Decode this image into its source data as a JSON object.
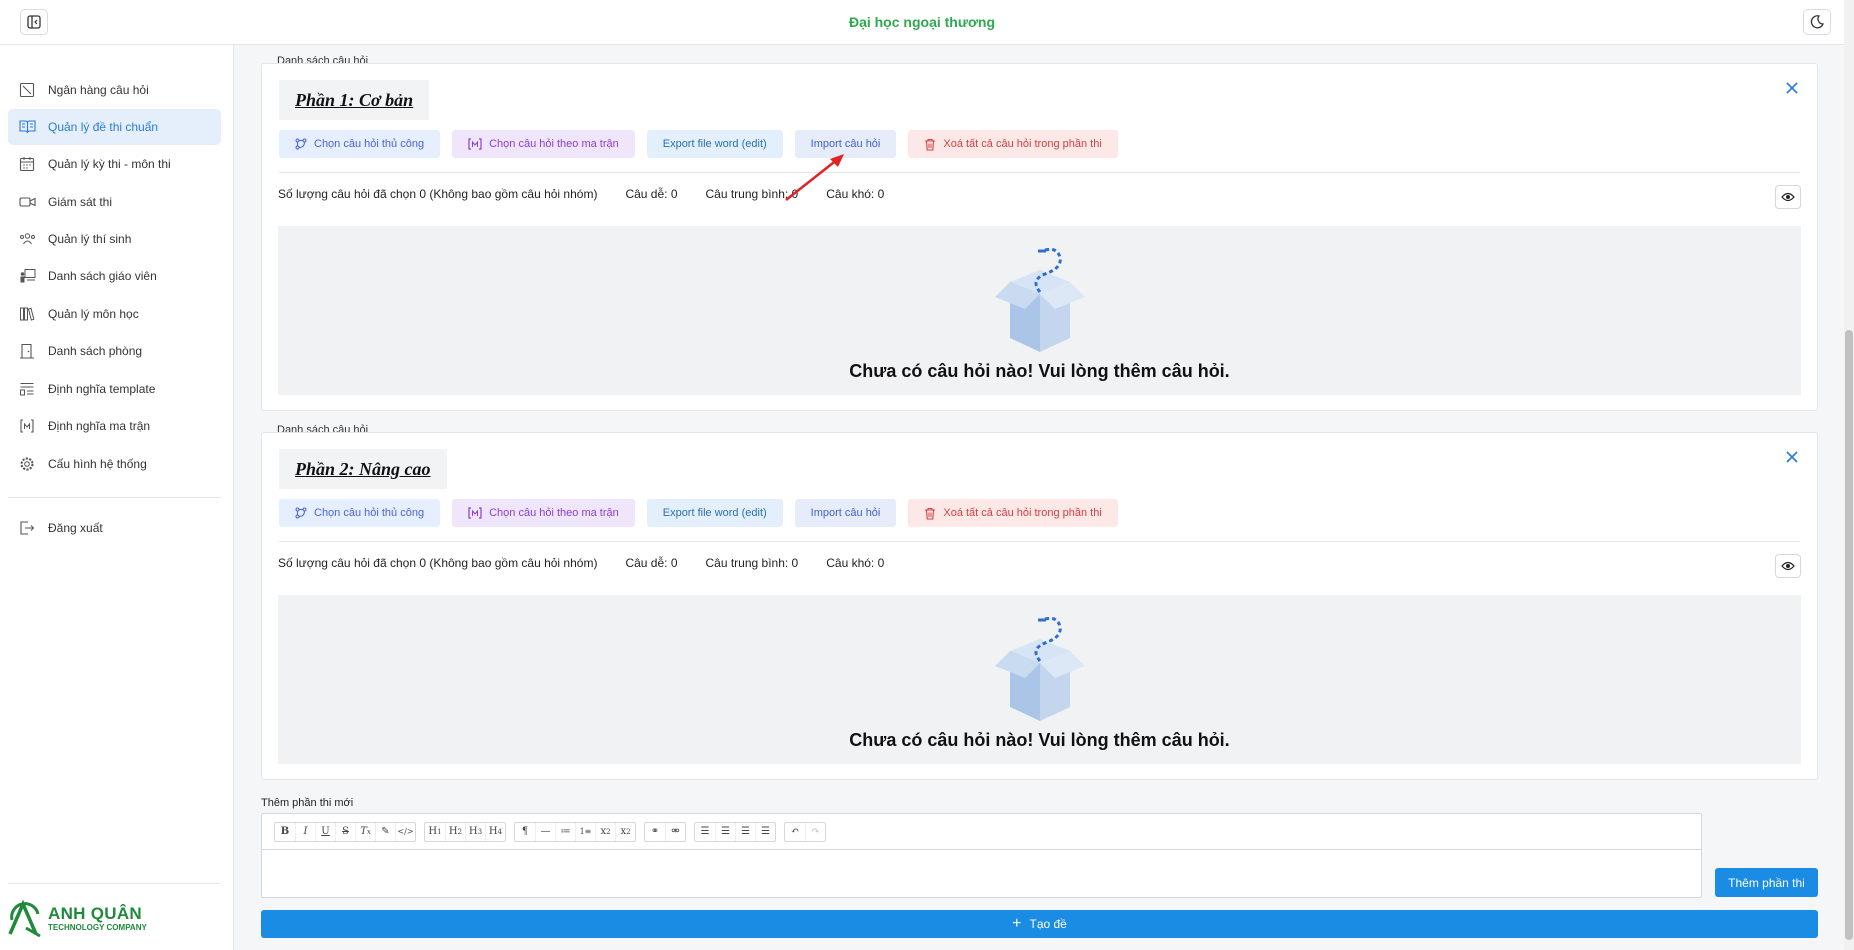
{
  "header": {
    "title": "Đại học ngoại thương",
    "toggle_sidebar_icon": "sidebar-toggle-icon",
    "theme_icon": "moon-icon"
  },
  "sidebar": {
    "items": [
      {
        "label": "Ngân hàng câu hỏi",
        "icon": "question-bank-icon"
      },
      {
        "label": "Quản lý đề thi chuẩn",
        "icon": "book-open-icon",
        "active": true
      },
      {
        "label": "Quản lý kỳ thi - môn thi",
        "icon": "calendar-icon"
      },
      {
        "label": "Giám sát thi",
        "icon": "video-camera-icon"
      },
      {
        "label": "Quản lý thí sinh",
        "icon": "users-icon"
      },
      {
        "label": "Danh sách giáo viên",
        "icon": "teacher-board-icon"
      },
      {
        "label": "Quản lý môn học",
        "icon": "library-books-icon"
      },
      {
        "label": "Danh sách phòng",
        "icon": "door-icon"
      },
      {
        "label": "Định nghĩa template",
        "icon": "template-layout-icon"
      },
      {
        "label": "Định nghĩa ma trận",
        "icon": "matrix-bracket-icon"
      },
      {
        "label": "Cấu hình hệ thống",
        "icon": "gear-icon"
      }
    ],
    "logout": {
      "label": "Đăng xuất",
      "icon": "logout-icon"
    },
    "logo": {
      "main": "ANH QUÂN",
      "sub": "TECHNOLOGY COMPANY"
    }
  },
  "sections": [
    {
      "legend": "Danh sách câu hỏi",
      "title": "Phần 1: Cơ bản",
      "buttons": {
        "manual": "Chọn câu hỏi thủ công",
        "matrix": "Chọn câu hỏi theo ma trận",
        "export": "Export file word (edit)",
        "import": "Import câu hỏi",
        "delete_all": "Xoá tất cả câu hỏi trong phần thi"
      },
      "stats": {
        "selected": "Số lượng câu hỏi đã chọn 0 (Không bao gồm câu hỏi nhóm)",
        "easy": "Câu dễ: 0",
        "medium": "Câu trung bình: 0",
        "hard": "Câu khó: 0"
      },
      "empty_message": "Chưa có câu hỏi nào! Vui lòng thêm câu hỏi."
    },
    {
      "legend": "Danh sách câu hỏi",
      "title": "Phần 2: Nâng cao",
      "buttons": {
        "manual": "Chọn câu hỏi thủ công",
        "matrix": "Chọn câu hỏi theo ma trận",
        "export": "Export file word (edit)",
        "import": "Import câu hỏi",
        "delete_all": "Xoá tất cả câu hỏi trong phần thi"
      },
      "stats": {
        "selected": "Số lượng câu hỏi đã chọn 0 (Không bao gồm câu hỏi nhóm)",
        "easy": "Câu dễ: 0",
        "medium": "Câu trung bình: 0",
        "hard": "Câu khó: 0"
      },
      "empty_message": "Chưa có câu hỏi nào! Vui lòng thêm câu hỏi."
    }
  ],
  "new_section": {
    "label": "Thêm phần thi mới",
    "editor_value": "",
    "toolbar": [
      "B",
      "I",
      "U",
      "S",
      "Tx",
      "✎",
      "</>",
      "H1",
      "H2",
      "H3",
      "H4",
      "¶",
      "—",
      "•",
      "1.",
      "x₂",
      "x²",
      "link",
      "unlink",
      "≡L",
      "≡C",
      "≡J",
      "≡R",
      "undo",
      "redo"
    ],
    "add_button": "Thêm phần thi",
    "create_button": "Tạo đề"
  },
  "colors": {
    "accent": "#1a8ce3",
    "brand_green": "#2fa84f",
    "active_bg": "#e4effb"
  }
}
